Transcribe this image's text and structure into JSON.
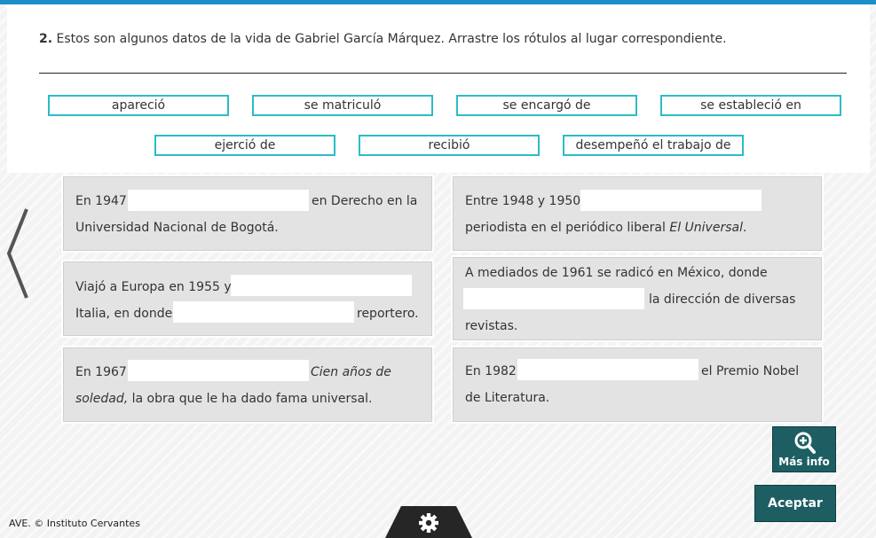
{
  "instruction": {
    "number": "2.",
    "text": "Estos son algunos datos de la vida de Gabriel García Márquez. Arrastre los rótulos al lugar correspondiente."
  },
  "labels": [
    "apareció",
    "se matriculó",
    "se encargó de",
    "se estableció en",
    "ejerció de",
    "recibió",
    "desempeñó el trabajo de"
  ],
  "cards": {
    "c1": {
      "a": "En 1947",
      "b": "en Derecho en la",
      "c": "Universidad Nacional de Bogotá."
    },
    "c2": {
      "a": "Entre 1948 y 1950",
      "b": "periodista en el periódico liberal ",
      "b_italic": "El Universal",
      "b_end": "."
    },
    "c3": {
      "a": "Viajó a Europa en 1955 y",
      "b": "Italia, en donde",
      "c": "reportero."
    },
    "c4": {
      "a": "A mediados de 1961 se radicó en México, donde",
      "b": "la dirección de diversas",
      "c": "revistas."
    },
    "c5": {
      "a": "En 1967",
      "a_italic": "Cien años de",
      "b_italic": "soledad,",
      "b": " la obra que le ha dado fama universal."
    },
    "c6": {
      "a": "En 1982",
      "b": "el Premio Nobel",
      "c": "de Literatura."
    }
  },
  "buttons": {
    "more_info": "Más info",
    "accept": "Aceptar"
  },
  "icons": {
    "prev": "chevron-left-icon",
    "zoom": "zoom-in-icon",
    "settings": "gear-icon"
  },
  "footer": {
    "copyright": "AVE. © Instituto Cervantes"
  },
  "colors": {
    "accent": "#2bbcc8",
    "button": "#1d5e63",
    "topbar": "#1b8fc9"
  }
}
